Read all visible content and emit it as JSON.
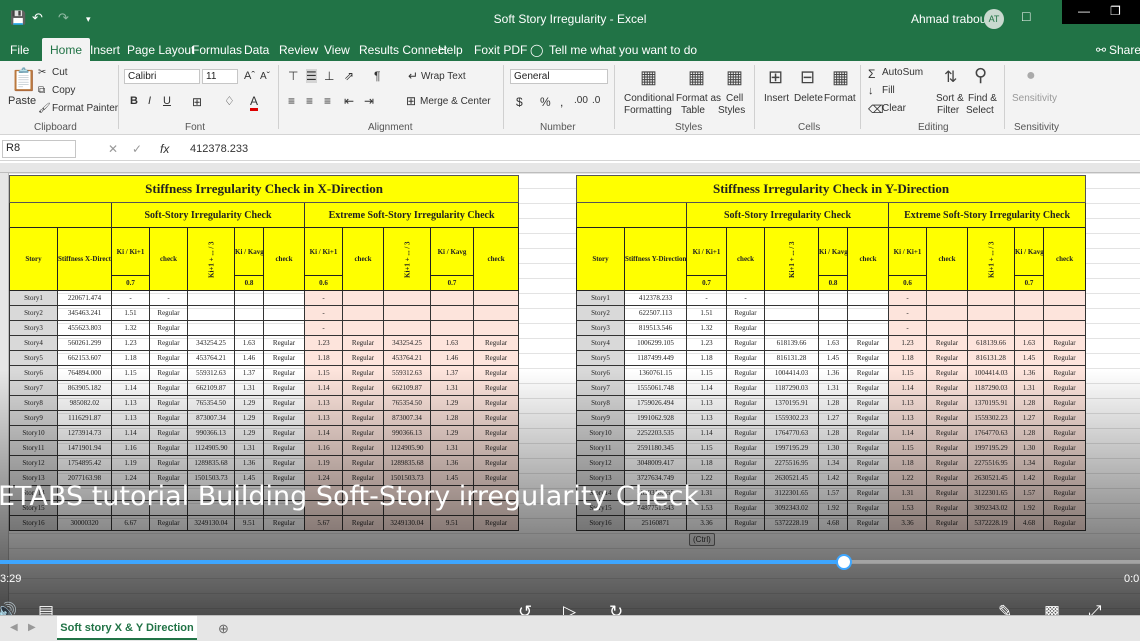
{
  "app": {
    "title": "Soft Story Irregularity  -  Excel",
    "user": "Ahmad traboulsi",
    "initials": "AT"
  },
  "tabs": [
    "File",
    "Home",
    "Insert",
    "Page Layout",
    "Formulas",
    "Data",
    "Review",
    "View",
    "Results Connect",
    "Help",
    "Foxit PDF"
  ],
  "tell_me": "Tell me what you want to do",
  "share": "Share",
  "ribbon": {
    "clipboard": {
      "paste": "Paste",
      "cut": "Cut",
      "copy": "Copy",
      "format_painter": "Format Painter",
      "label": "Clipboard"
    },
    "font": {
      "name": "Calibri",
      "size": "11",
      "label": "Font"
    },
    "alignment": {
      "wrap": "Wrap Text",
      "merge": "Merge & Center",
      "label": "Alignment"
    },
    "number": {
      "format": "General",
      "label": "Number"
    },
    "styles": {
      "conditional": "Conditional",
      "formatting": "Formatting",
      "format_as": "Format as",
      "table": "Table",
      "cell": "Cell",
      "cell_styles": "Styles",
      "label": "Styles"
    },
    "cells": {
      "insert": "Insert",
      "delete": "Delete",
      "format": "Format",
      "label": "Cells"
    },
    "editing": {
      "autosum": "AutoSum",
      "fill": "Fill",
      "clear": "Clear",
      "sort": "Sort &",
      "filter": "Filter",
      "find": "Find &",
      "select": "Select",
      "label": "Editing"
    },
    "sensitivity": {
      "label": "Sensitivity",
      "btn": "Sensitivity"
    }
  },
  "formula_bar": {
    "name_box": "R8",
    "value": "412378.233"
  },
  "x_table": {
    "title": "Stiffness Irregularity Check in X-Direction",
    "soft": "Soft-Story Irregularity Check",
    "extreme": "Extreme Soft-Story Irregularity Check",
    "story_hdr": "Story",
    "stiff_hdr": "Stiffness X-Direction",
    "k_ratio": "Ki / Ki+1",
    "check": "check",
    "k_avg": "Ki+1 + ... / 3",
    "k_avg_ratio": "Ki / Kavg",
    "limits": [
      "0.7",
      "0.8",
      "0.6",
      "0.7"
    ],
    "rows": [
      [
        "Story1",
        "220671.474",
        "-",
        "-",
        "",
        "",
        "",
        "-",
        "",
        "",
        "",
        ""
      ],
      [
        "Story2",
        "345463.241",
        "1.51",
        "Regular",
        "",
        "",
        "",
        "-",
        "",
        "",
        "",
        ""
      ],
      [
        "Story3",
        "455623.803",
        "1.32",
        "Regular",
        "",
        "",
        "",
        "-",
        "",
        "",
        "",
        ""
      ],
      [
        "Story4",
        "560261.299",
        "1.23",
        "Regular",
        "343254.25",
        "1.63",
        "Regular",
        "1.23",
        "Regular",
        "343254.25",
        "1.63",
        "Regular"
      ],
      [
        "Story5",
        "662153.607",
        "1.18",
        "Regular",
        "453764.21",
        "1.46",
        "Regular",
        "1.18",
        "Regular",
        "453764.21",
        "1.46",
        "Regular"
      ],
      [
        "Story6",
        "764894.000",
        "1.15",
        "Regular",
        "559312.63",
        "1.37",
        "Regular",
        "1.15",
        "Regular",
        "559312.63",
        "1.37",
        "Regular"
      ],
      [
        "Story7",
        "863905.182",
        "1.14",
        "Regular",
        "662109.87",
        "1.31",
        "Regular",
        "1.14",
        "Regular",
        "662109.87",
        "1.31",
        "Regular"
      ],
      [
        "Story8",
        "985082.02",
        "1.13",
        "Regular",
        "765354.50",
        "1.29",
        "Regular",
        "1.13",
        "Regular",
        "765354.50",
        "1.29",
        "Regular"
      ],
      [
        "Story9",
        "1116291.87",
        "1.13",
        "Regular",
        "873007.34",
        "1.29",
        "Regular",
        "1.13",
        "Regular",
        "873007.34",
        "1.28",
        "Regular"
      ],
      [
        "Story10",
        "1273914.73",
        "1.14",
        "Regular",
        "990366.13",
        "1.29",
        "Regular",
        "1.14",
        "Regular",
        "990366.13",
        "1.29",
        "Regular"
      ],
      [
        "Story11",
        "1471901.94",
        "1.16",
        "Regular",
        "1124905.90",
        "1.31",
        "Regular",
        "1.16",
        "Regular",
        "1124905.90",
        "1.31",
        "Regular"
      ],
      [
        "Story12",
        "1754895.42",
        "1.19",
        "Regular",
        "1289835.68",
        "1.36",
        "Regular",
        "1.19",
        "Regular",
        "1289835.68",
        "1.36",
        "Regular"
      ],
      [
        "Story13",
        "2077163.98",
        "1.24",
        "Regular",
        "1501503.73",
        "1.45",
        "Regular",
        "1.24",
        "Regular",
        "1501503.73",
        "1.45",
        "Regular"
      ],
      [
        "Story14",
        "",
        "",
        "",
        "",
        "",
        "",
        "",
        "",
        "",
        "",
        ""
      ],
      [
        "Story15",
        "",
        "",
        "",
        "",
        "",
        "",
        "",
        "",
        "",
        "",
        ""
      ],
      [
        "Story16",
        "30000320",
        "6.67",
        "Regular",
        "3249130.04",
        "9.51",
        "Regular",
        "5.67",
        "Regular",
        "3249130.04",
        "9.51",
        "Regular"
      ]
    ]
  },
  "y_table": {
    "title": "Stiffness Irregularity Check in Y-Direction",
    "soft": "Soft-Story Irregularity Check",
    "extreme": "Extreme Soft-Story Irregularity Check",
    "story_hdr": "Story",
    "stiff_hdr": "Stiffness Y-Direction",
    "k_ratio": "Ki / Ki+1",
    "check": "check",
    "k_avg": "Ki+1 + ... / 3",
    "k_avg_ratio": "Ki / Kavg",
    "limits": [
      "0.7",
      "0.8",
      "0.6",
      "0.7"
    ],
    "rows": [
      [
        "Story1",
        "412378.233",
        "-",
        "-",
        "",
        "",
        "",
        "-",
        "",
        "",
        "",
        ""
      ],
      [
        "Story2",
        "622507.113",
        "1.51",
        "Regular",
        "",
        "",
        "",
        "-",
        "",
        "",
        "",
        ""
      ],
      [
        "Story3",
        "819513.546",
        "1.32",
        "Regular",
        "",
        "",
        "",
        "-",
        "",
        "",
        "",
        ""
      ],
      [
        "Story4",
        "1006299.105",
        "1.23",
        "Regular",
        "618139.66",
        "1.63",
        "Regular",
        "1.23",
        "Regular",
        "618139.66",
        "1.63",
        "Regular"
      ],
      [
        "Story5",
        "1187499.449",
        "1.18",
        "Regular",
        "816131.28",
        "1.45",
        "Regular",
        "1.18",
        "Regular",
        "816131.28",
        "1.45",
        "Regular"
      ],
      [
        "Story6",
        "1360761.15",
        "1.15",
        "Regular",
        "1004414.03",
        "1.36",
        "Regular",
        "1.15",
        "Regular",
        "1004414.03",
        "1.36",
        "Regular"
      ],
      [
        "Story7",
        "1555061.748",
        "1.14",
        "Regular",
        "1187290.03",
        "1.31",
        "Regular",
        "1.14",
        "Regular",
        "1187290.03",
        "1.31",
        "Regular"
      ],
      [
        "Story8",
        "1759026.494",
        "1.13",
        "Regular",
        "1370195.91",
        "1.28",
        "Regular",
        "1.13",
        "Regular",
        "1370195.91",
        "1.28",
        "Regular"
      ],
      [
        "Story9",
        "1991062.928",
        "1.13",
        "Regular",
        "1559302.23",
        "1.27",
        "Regular",
        "1.13",
        "Regular",
        "1559302.23",
        "1.27",
        "Regular"
      ],
      [
        "Story10",
        "2252203.535",
        "1.14",
        "Regular",
        "1764770.63",
        "1.28",
        "Regular",
        "1.14",
        "Regular",
        "1764770.63",
        "1.28",
        "Regular"
      ],
      [
        "Story11",
        "2591180.345",
        "1.15",
        "Regular",
        "1997195.29",
        "1.30",
        "Regular",
        "1.15",
        "Regular",
        "1997195.29",
        "1.30",
        "Regular"
      ],
      [
        "Story12",
        "3048009.417",
        "1.18",
        "Regular",
        "2275516.95",
        "1.34",
        "Regular",
        "1.18",
        "Regular",
        "2275516.95",
        "1.34",
        "Regular"
      ],
      [
        "Story13",
        "3727634.749",
        "1.22",
        "Regular",
        "2630521.45",
        "1.42",
        "Regular",
        "1.22",
        "Regular",
        "2630521.45",
        "1.42",
        "Regular"
      ],
      [
        "Story14",
        "4890318.655",
        "1.31",
        "Regular",
        "3122301.65",
        "1.57",
        "Regular",
        "1.31",
        "Regular",
        "3122301.65",
        "1.57",
        "Regular"
      ],
      [
        "Story15",
        "7487751.543",
        "1.53",
        "Regular",
        "3092343.02",
        "1.92",
        "Regular",
        "1.53",
        "Regular",
        "3092343.02",
        "1.92",
        "Regular"
      ],
      [
        "Story16",
        "25160871",
        "3.36",
        "Regular",
        "5372228.19",
        "4.68",
        "Regular",
        "3.36",
        "Regular",
        "5372228.19",
        "4.68",
        "Regular"
      ]
    ]
  },
  "paste_options": "(Ctrl)",
  "video": {
    "caption": "ETABS tutorial Building Soft-Story irregularity Check",
    "time_left": "3:29",
    "time_right": "0:0",
    "progress": 0.74
  },
  "sheet_tab": "Soft story X & Y Direction"
}
